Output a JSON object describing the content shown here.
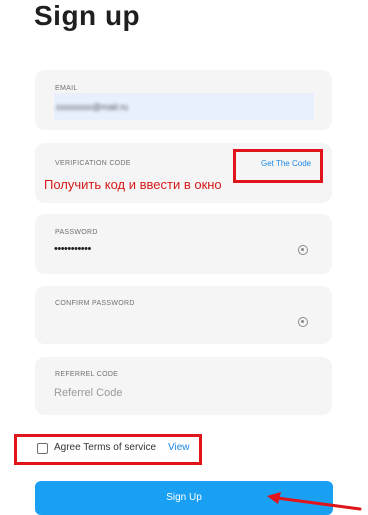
{
  "page": {
    "title": "Sign up"
  },
  "form": {
    "email": {
      "label": "EMAIL",
      "value": "xxxxxxxx@mail.ru"
    },
    "verification": {
      "label": "VERIFICATION CODE",
      "get_code_label": "Get The Code"
    },
    "password": {
      "label": "PASSWORD",
      "value": "•••••••••••"
    },
    "confirm_password": {
      "label": "CONFIRM PASSWORD",
      "value": ""
    },
    "referrel": {
      "label": "REFERREL CODE",
      "placeholder": "Referrel Code"
    },
    "agree": {
      "text": "Agree Terms of service",
      "link": "View",
      "checked": false
    },
    "submit_label": "Sign Up"
  },
  "annotation": {
    "ru_note": "Получить код и ввести в окно",
    "color": "#e0141a"
  },
  "colors": {
    "accent": "#1aa0f2",
    "link": "#1e88e5",
    "card_bg": "#f5f5f5"
  },
  "icons": {
    "password_toggle": "eye-icon"
  }
}
